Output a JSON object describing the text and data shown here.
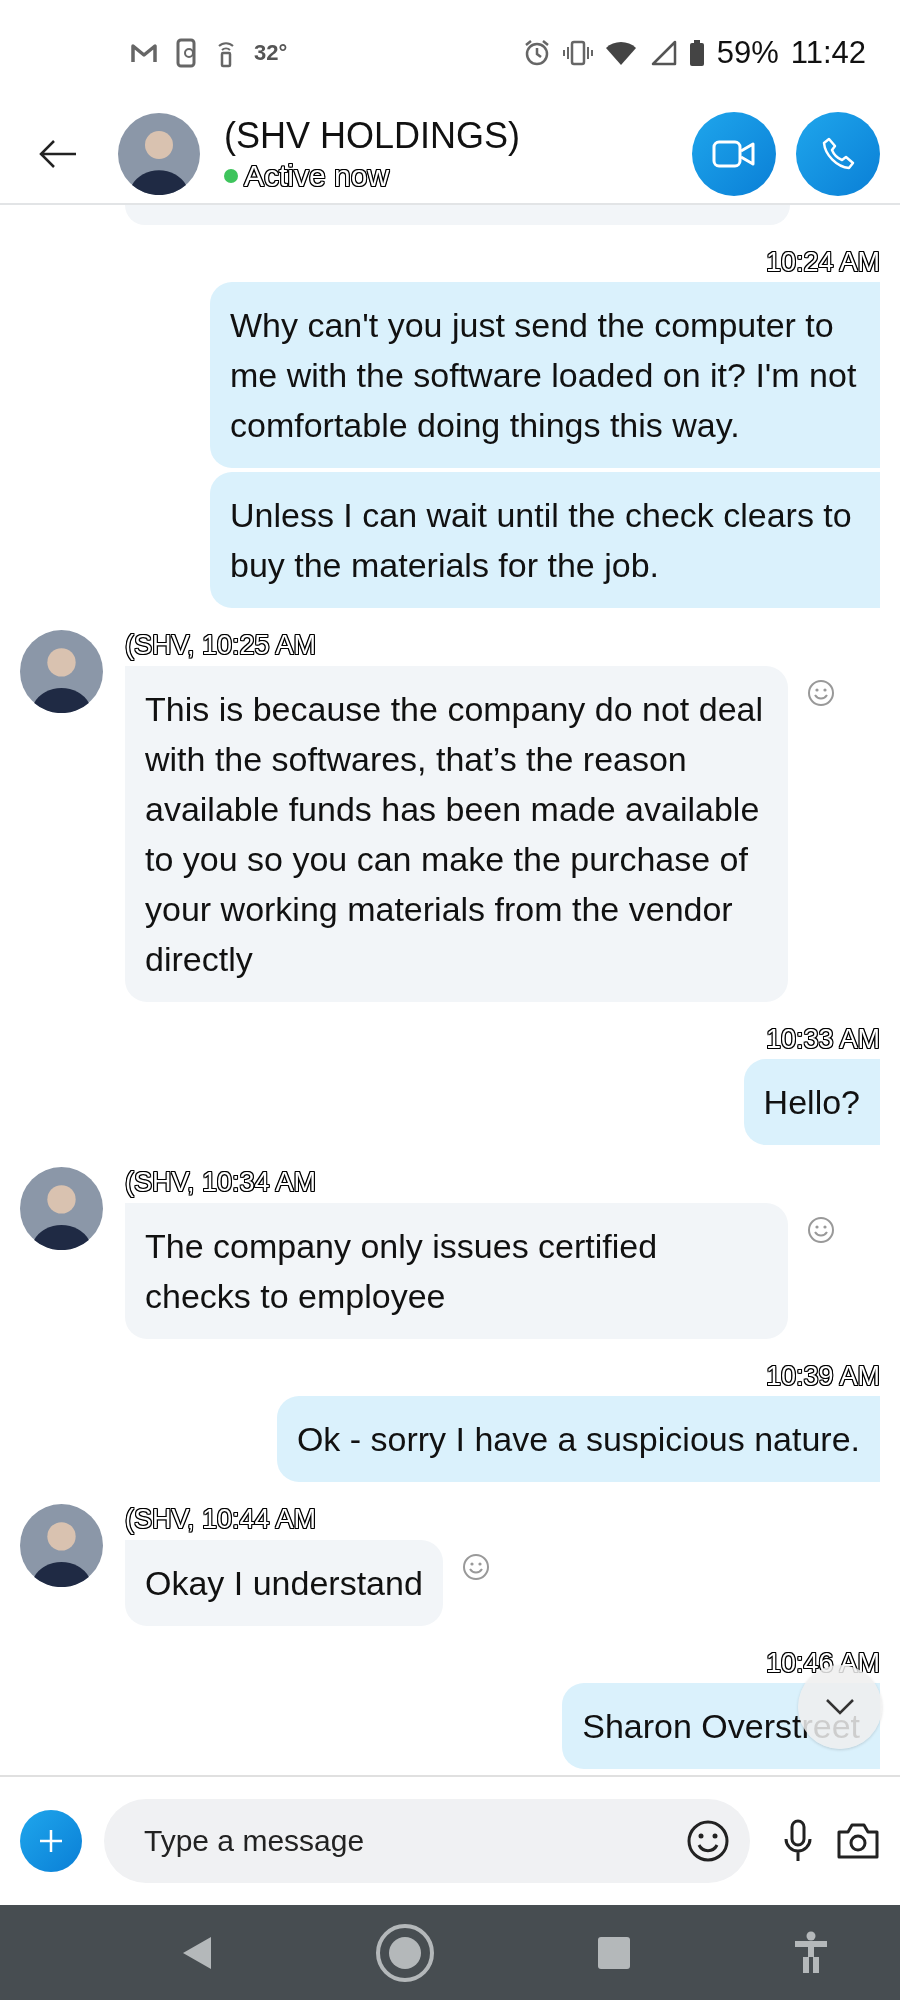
{
  "status_bar": {
    "temperature": "32°",
    "battery": "59%",
    "time": "11:42"
  },
  "header": {
    "title": "(SHV HOLDINGS)",
    "status": "Active now",
    "online": true
  },
  "messages": [
    {
      "kind": "outgoing",
      "time": "10:24 AM",
      "bubbles": [
        "Why can't you just send the computer to me with the software loaded on it? I'm not comfortable doing things this way.",
        "Unless I can wait until the check clears to buy the materials for the job."
      ]
    },
    {
      "kind": "incoming",
      "label": "(SHV, 10:25 AM",
      "bubbles": [
        "This is because the company do not deal with the softwares, that’s the reason available funds has been made available to you so you can make the purchase of your working materials from the vendor directly"
      ]
    },
    {
      "kind": "outgoing",
      "time": "10:33 AM",
      "bubbles": [
        "Hello?"
      ]
    },
    {
      "kind": "incoming",
      "label": "(SHV, 10:34 AM",
      "bubbles": [
        "The company only issues certified checks to employee"
      ]
    },
    {
      "kind": "outgoing",
      "time": "10:39 AM",
      "bubbles": [
        "Ok - sorry I have a suspicious nature."
      ]
    },
    {
      "kind": "incoming",
      "label": "(SHV, 10:44 AM",
      "bubbles": [
        "Okay I understand"
      ]
    },
    {
      "kind": "outgoing",
      "time": "10:46 AM",
      "bubbles": [
        "Sharon Overstreet"
      ]
    }
  ],
  "composer": {
    "placeholder": "Type a message"
  }
}
